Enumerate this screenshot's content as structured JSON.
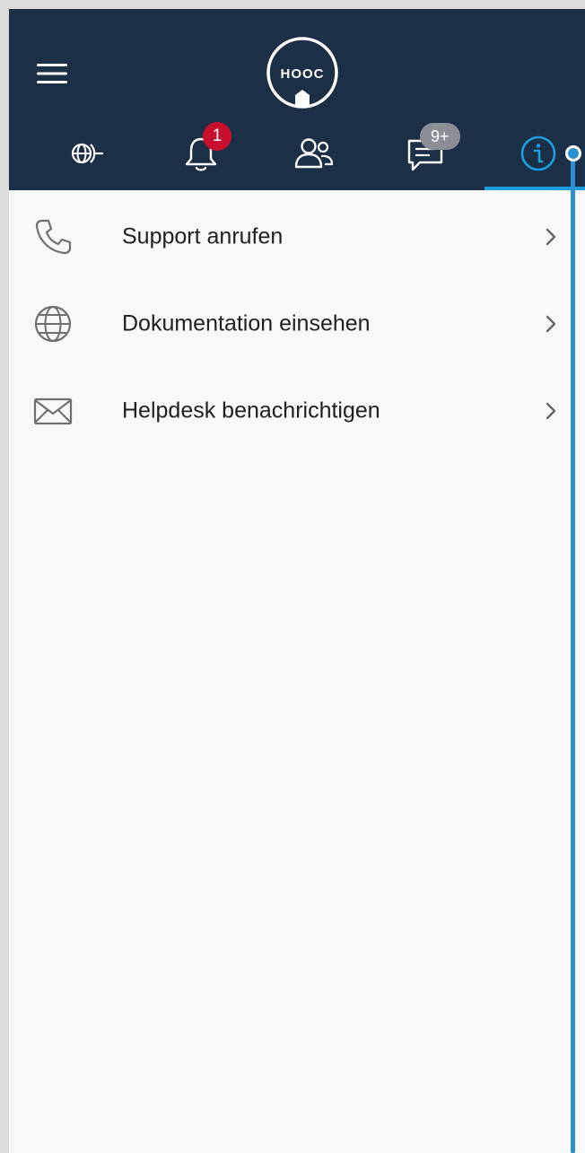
{
  "app": {
    "logo_text": "HOOC"
  },
  "colors": {
    "header_bg": "#1b2f46",
    "accent": "#1b9fe2",
    "badge_red": "#c8102e",
    "badge_gray": "#8a8f96",
    "content_bg": "#f8f8f8"
  },
  "header": {
    "menu_icon": "hamburger-menu-icon",
    "tabs": [
      {
        "icon": "network-globe-icon",
        "badge": null,
        "active": false
      },
      {
        "icon": "bell-icon",
        "badge": "1",
        "active": false
      },
      {
        "icon": "users-icon",
        "badge": null,
        "active": false
      },
      {
        "icon": "chat-icon",
        "badge": "9+",
        "active": false
      },
      {
        "icon": "info-icon",
        "badge": null,
        "active": true
      }
    ]
  },
  "list": {
    "items": [
      {
        "icon": "phone-icon",
        "label": "Support anrufen"
      },
      {
        "icon": "globe-icon",
        "label": "Dokumentation einsehen"
      },
      {
        "icon": "mail-icon",
        "label": "Helpdesk benachrichtigen"
      }
    ]
  }
}
